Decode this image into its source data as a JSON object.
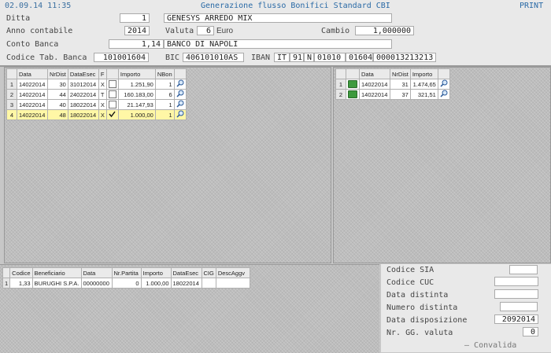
{
  "header": {
    "datetime": "02.09.14 11:35",
    "title": "Generazione flusso Bonifici Standard CBI",
    "print_label": "PRINT"
  },
  "form": {
    "ditta_label": "Ditta",
    "ditta_value": "1",
    "ditta_name": "GENESYS ARREDO MIX",
    "anno_label": "Anno contabile",
    "anno_value": "2014",
    "valuta_label": "Valuta",
    "valuta_value": "6",
    "valuta_name": "Euro",
    "cambio_label": "Cambio",
    "cambio_value": "1,000000",
    "conto_label": "Conto Banca",
    "conto_value": "1,14",
    "conto_name": "BANCO DI NAPOLI",
    "codtab_label": "Codice Tab. Banca",
    "codtab_value": "101001604",
    "bic_label": "BIC",
    "bic_value": "406101010AS",
    "iban_label": "IBAN",
    "iban_country": "IT",
    "iban_check": "91",
    "iban_cin": "N",
    "iban_abi": "01010",
    "iban_cab": "01604",
    "iban_account": "000013213213"
  },
  "grid_left": {
    "headers": [
      "Data",
      "NrDist",
      "DataEsec",
      "F",
      "Importo",
      "NBon"
    ],
    "rows": [
      {
        "n": "1",
        "data": "14022014",
        "nrdist": "30",
        "dataesec": "31012014",
        "f": "X",
        "importo": "1.251,90",
        "nbon": "1",
        "checked": false
      },
      {
        "n": "2",
        "data": "14022014",
        "nrdist": "44",
        "dataesec": "24022014",
        "f": "T",
        "importo": "160.183,00",
        "nbon": "6",
        "checked": false
      },
      {
        "n": "3",
        "data": "14022014",
        "nrdist": "40",
        "dataesec": "18022014",
        "f": "X",
        "importo": "21.147,93",
        "nbon": "1",
        "checked": false
      },
      {
        "n": "4",
        "data": "14022014",
        "nrdist": "48",
        "dataesec": "18022014",
        "f": "X",
        "importo": "1.000,00",
        "nbon": "1",
        "checked": true
      }
    ]
  },
  "grid_right": {
    "headers": [
      "Data",
      "NrDist",
      "Importo"
    ],
    "rows": [
      {
        "n": "1",
        "data": "14022014",
        "nrdist": "31",
        "importo": "1.474,65"
      },
      {
        "n": "2",
        "data": "14022014",
        "nrdist": "37",
        "importo": "321,51"
      }
    ]
  },
  "grid_bottom": {
    "headers": [
      "Codice",
      "Beneficiario",
      "Data",
      "Nr.Partita",
      "Importo",
      "DataEsec",
      "CIG",
      "DescAggv"
    ],
    "rows": [
      {
        "n": "1",
        "codice": "1,33",
        "beneficiario": "BURUGHI S.P.A.",
        "data": "00000000",
        "nrpartita": "0",
        "importo": "1.000,00",
        "dataesec": "18022014",
        "cig": "",
        "descaggv": ""
      }
    ]
  },
  "side": {
    "sia_label": "Codice SIA",
    "sia_value": "",
    "cuc_label": "Codice CUC",
    "cuc_value": "",
    "data_distinta_label": "Data  distinta",
    "data_distinta_value": "",
    "numero_distinta_label": "Numero distinta",
    "numero_distinta_value": "",
    "data_disposizione_label": "Data disposizione",
    "data_disposizione_value": "2092014",
    "gg_valuta_label": "Nr. GG. valuta",
    "gg_valuta_value": "0",
    "convalida_label": "Convalida"
  }
}
